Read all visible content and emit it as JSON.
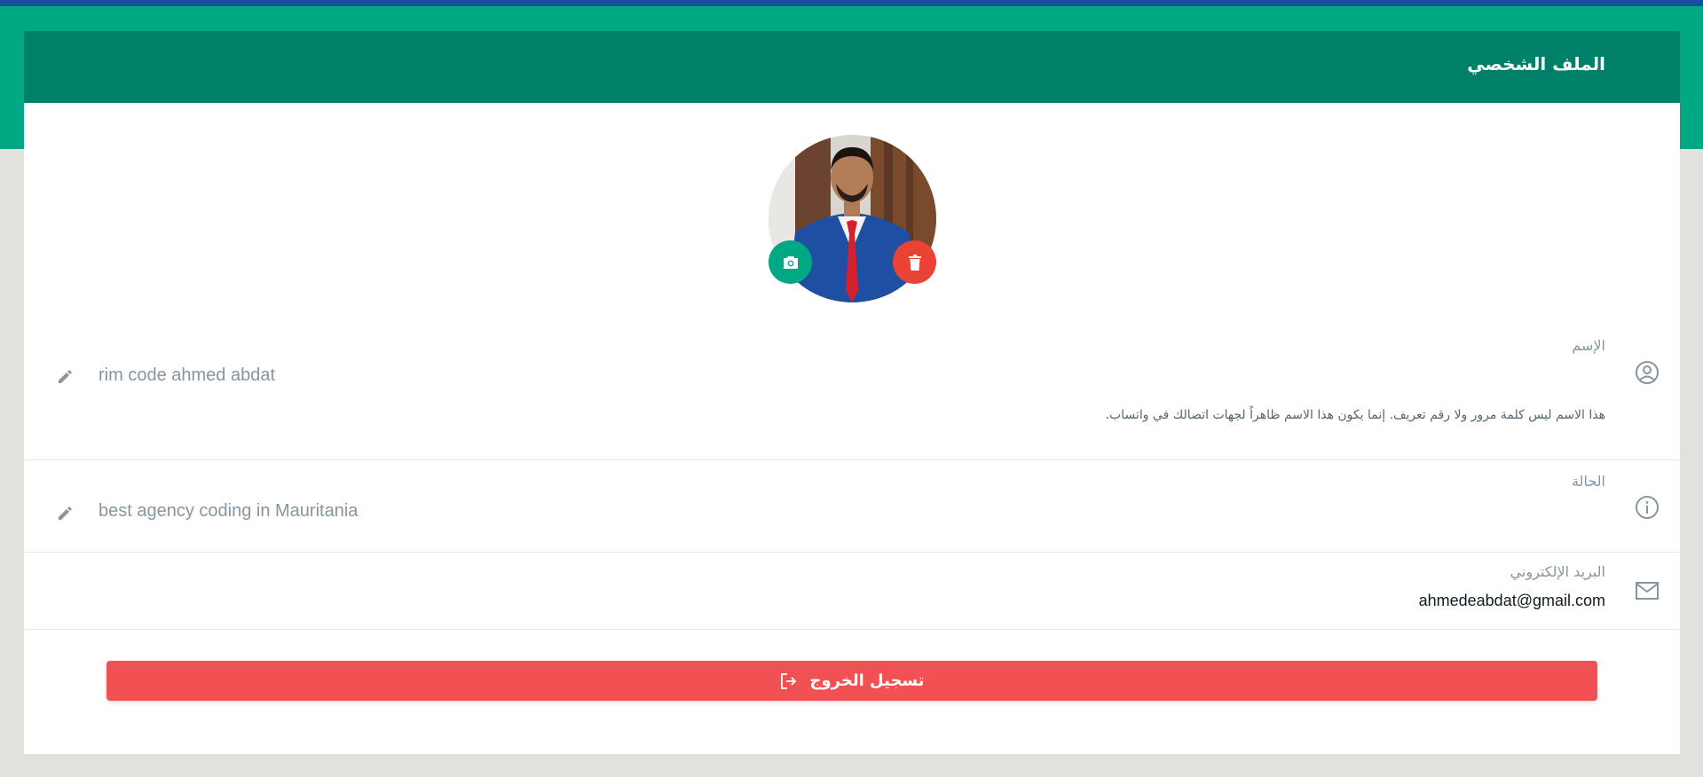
{
  "header": {
    "title": "الملف الشخصي"
  },
  "avatar": {
    "camera_icon": "camera-icon",
    "delete_icon": "trash-icon"
  },
  "name_field": {
    "label": "الإسم",
    "value": "rim code ahmed abdat",
    "hint": "هذا الاسم ليس كلمة مرور ولا رقم تعريف. إنما يكون هذا الاسم ظاهراً لجهات اتصالك في واتساب.",
    "icon": "user-circle-icon"
  },
  "status_field": {
    "label": "الحالة",
    "value": "best agency coding in Mauritania",
    "icon": "info-icon"
  },
  "email_field": {
    "label": "البريد الإلكتروني",
    "value": "ahmedeabdat@gmail.com",
    "icon": "mail-icon"
  },
  "logout": {
    "label": "تسجيل الخروج",
    "icon": "logout-icon"
  },
  "colors": {
    "header": "#008069",
    "accent": "#00a884",
    "danger": "#f15152",
    "delete": "#ea4335"
  }
}
